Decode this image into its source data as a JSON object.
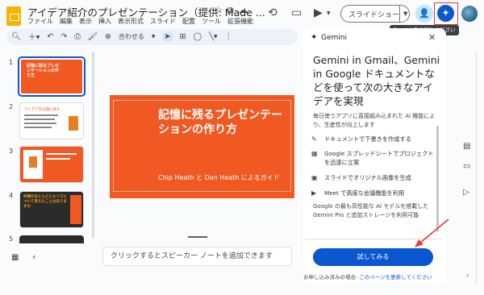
{
  "window": {
    "title": "アイデア紹介のプレゼンテーション（提供: Made ...",
    "title_icons": [
      "star-icon",
      "move-folder-icon",
      "cloud-status-icon"
    ]
  },
  "menu": [
    "ファイル",
    "編集",
    "表示",
    "挿入",
    "表示形式",
    "スライド",
    "配置",
    "ツール",
    "拡張機能"
  ],
  "header": {
    "slideshow_label": "スライドショー",
    "tooltip": "Gemini をお試しください"
  },
  "toolbar": {
    "fit_label": "合わせる"
  },
  "filmstrip": {
    "numbers": [
      "1",
      "2",
      "3",
      "4",
      "5"
    ],
    "slide1_caption": "記憶に残るプレゼンテーションの作り方",
    "slide2_caption": "アイデアを記憶に残す",
    "slide4_caption": "仲間のほとんどとエリスについて考えたことはありますか"
  },
  "slide": {
    "title": "記憶に残るプレゼンテーションの作り方",
    "subtitle": "Chip Heath と Dan Heath によるガイド"
  },
  "notes": {
    "placeholder": "クリックするとスピーカー ノートを追加できます"
  },
  "gemini": {
    "header": "Gemini",
    "title": "Gemini in Gmail、Gemini in Google ドキュメントなどを使って次の大きなアイデアを実現",
    "intro": "毎日使うアプリに直接組み込まれた AI 機能により、生産性が向上します",
    "features": [
      {
        "icon": "pen-spark-icon",
        "text": "ドキュメントで下書きを作成する"
      },
      {
        "icon": "sheets-icon",
        "text": "Google スプレッドシートでプロジェクトを迅速に立案"
      },
      {
        "icon": "image-icon",
        "text": "スライドでオリジナル画像を生成"
      },
      {
        "icon": "meet-icon",
        "text": "Meet で高度な会議機能を利用"
      }
    ],
    "footer": "Google の最も高性能な AI モデルを搭載した Gemini Pro と追加ストレージを利用可能",
    "try_button": "試してみる",
    "bottom_text": "お申し込み済みの場合: ",
    "bottom_link": "このページを更新してください"
  }
}
